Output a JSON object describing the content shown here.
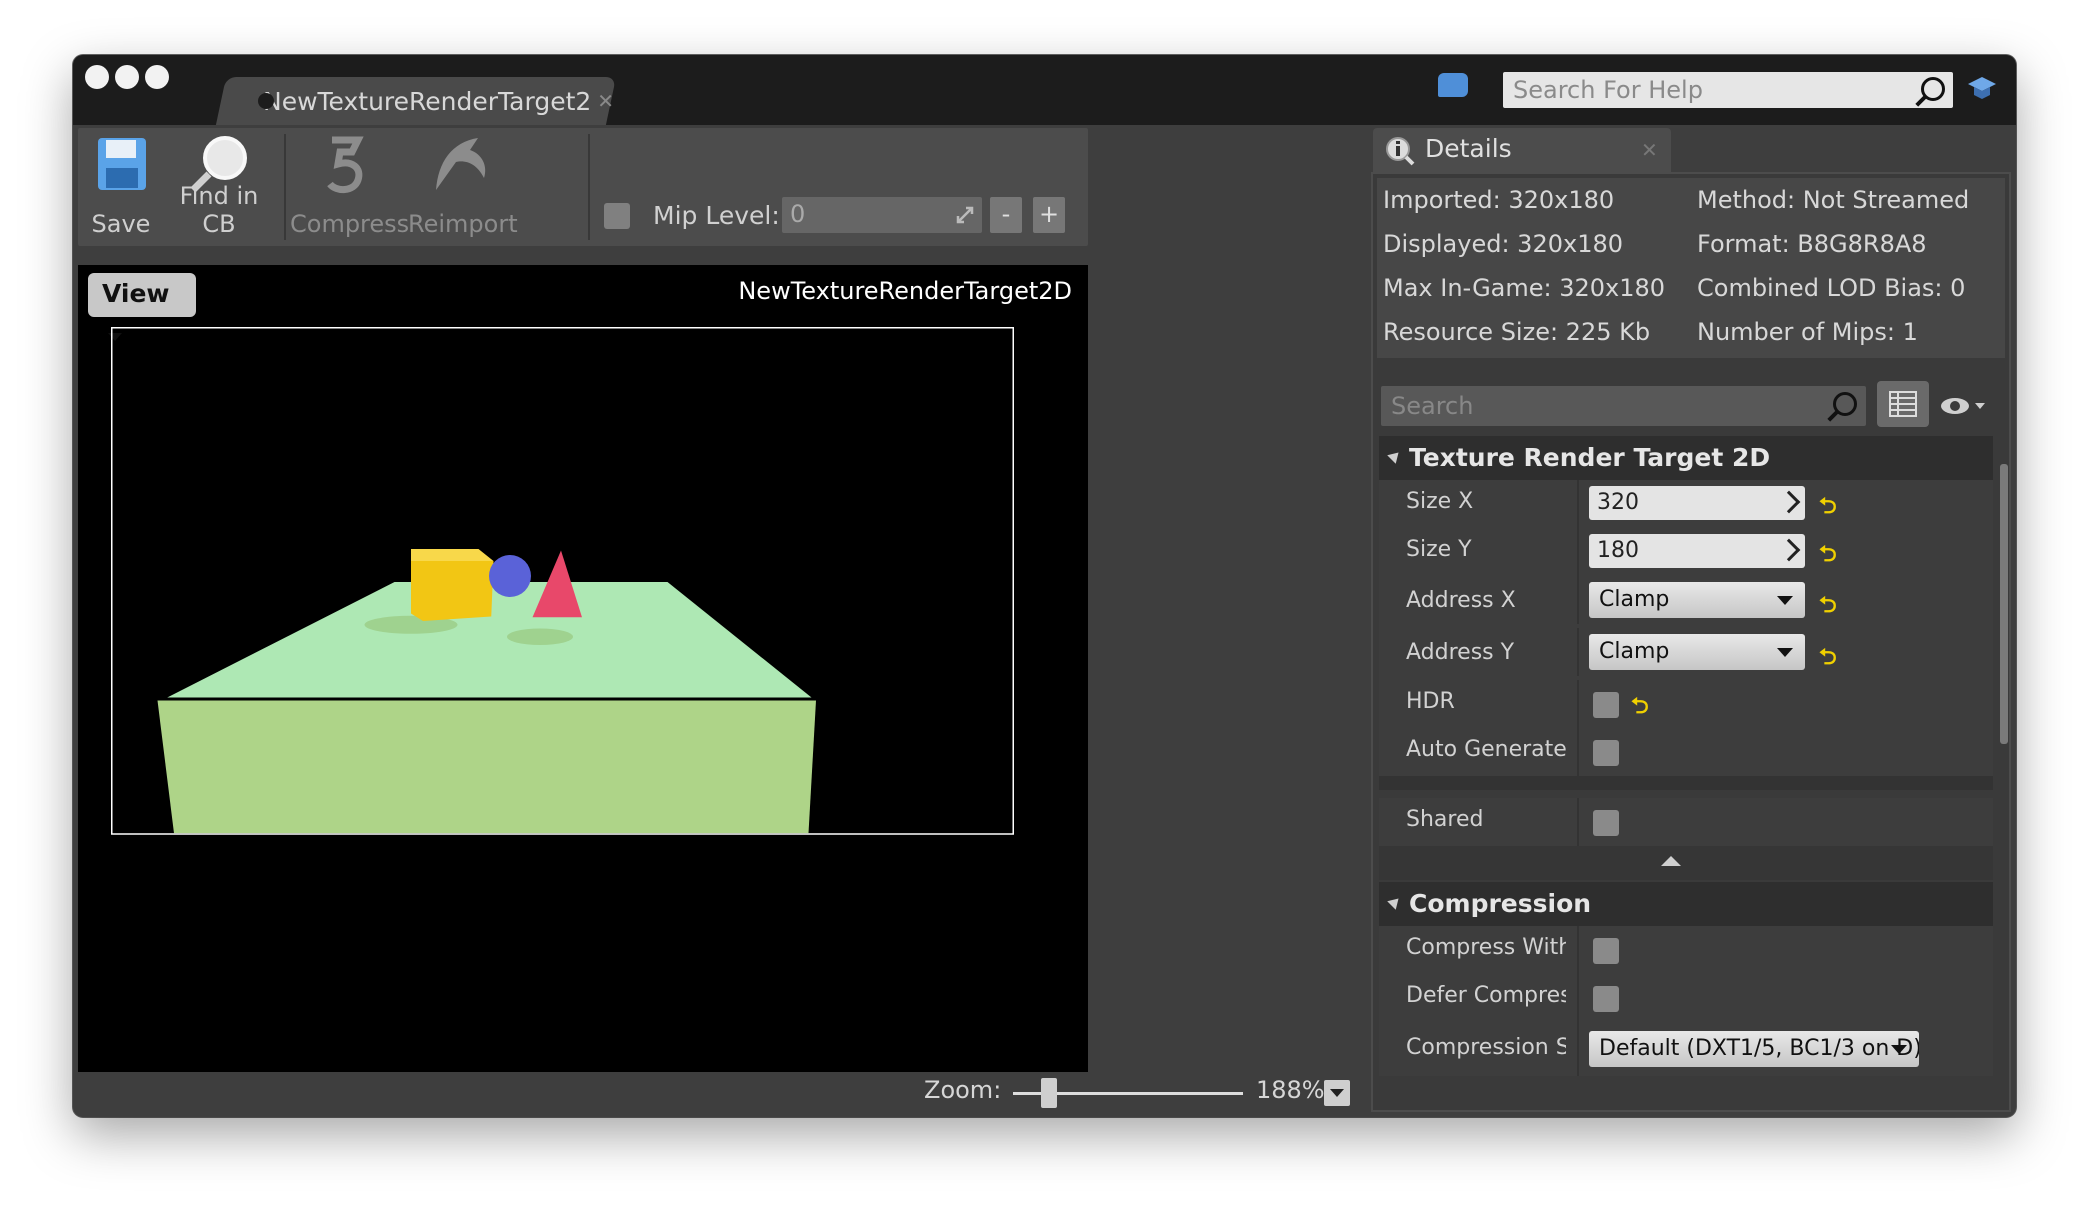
{
  "window": {
    "tab_title": "NewTextureRenderTarget2",
    "help_search_placeholder": "Search For Help"
  },
  "toolbar": {
    "save_label": "Save",
    "find_in_cb_label": "Find in CB",
    "compress_label": "Compress",
    "reimport_label": "Reimport",
    "mip_level_label": "Mip Level:",
    "mip_level_value": "0",
    "mip_minus": "-",
    "mip_plus": "+"
  },
  "viewport": {
    "view_button_label": "View",
    "asset_name": "NewTextureRenderTarget2D",
    "zoom_label": "Zoom:",
    "zoom_value": "188%",
    "scene_colors": {
      "table_top": "#aee8b4",
      "table_side": "#aed488",
      "cube": "#f2c614",
      "sphere": "#5a62d8",
      "cone": "#e8486a",
      "background": "#000000"
    }
  },
  "details": {
    "tab_title": "Details",
    "info_left": [
      "Imported: 320x180",
      "Displayed: 320x180",
      "Max In-Game: 320x180",
      "Resource Size: 225 Kb"
    ],
    "info_right": [
      "Method: Not Streamed",
      "Format: B8G8R8A8",
      "Combined LOD Bias: 0",
      "Number of Mips: 1"
    ],
    "search_placeholder": "Search",
    "categories": {
      "render_target": {
        "title": "Texture Render Target 2D",
        "size_x_label": "Size X",
        "size_x_value": "320",
        "size_y_label": "Size Y",
        "size_y_value": "180",
        "address_x_label": "Address X",
        "address_x_value": "Clamp",
        "address_y_label": "Address Y",
        "address_y_value": "Clamp",
        "hdr_label": "HDR",
        "auto_generate_label": "Auto Generate M",
        "shared_label": "Shared"
      },
      "compression": {
        "title": "Compression",
        "compress_without_label": "Compress Withoı",
        "defer_compression_label": "Defer Compressi",
        "compression_settings_label": "Compression Set",
        "compression_settings_value": "Default (DXT1/5, BC1/3 on D)"
      }
    },
    "reset_glyph": "⮌"
  }
}
